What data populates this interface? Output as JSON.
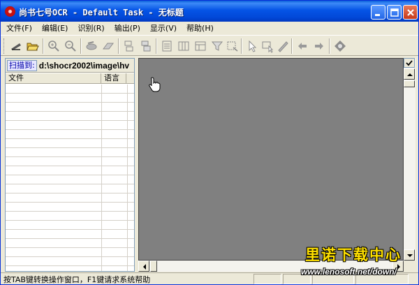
{
  "window": {
    "title": "尚书七号OCR - Default Task - 无标题",
    "controls": [
      "minimize-icon",
      "maximize-icon",
      "close-icon"
    ]
  },
  "menu": [
    "文件(F)",
    "编辑(E)",
    "识别(R)",
    "输出(P)",
    "显示(V)",
    "帮助(H)"
  ],
  "toolbar": {
    "icons": [
      "scan-icon",
      "open-folder-icon",
      "zoom-in-icon",
      "zoom-out-icon",
      "rotate-icon",
      "eraser-icon",
      "region-icon",
      "region-remove-icon",
      "text-block-icon",
      "table-block-icon",
      "image-block-icon",
      "filter-icon",
      "crop-icon",
      "pointer-icon",
      "select-region-icon",
      "pen-icon",
      "arrow-left-icon",
      "arrow-right-icon",
      "recognize-icon"
    ]
  },
  "left_panel": {
    "scan_label": "扫描到:",
    "path": "d:\\shocr2002\\image\\hv",
    "columns": [
      "文件",
      "语言"
    ],
    "rows": []
  },
  "status": {
    "text": "按TAB键转换操作窗口，F1键请求系统帮助"
  },
  "watermark": {
    "title": "里诺下载中心",
    "url": "www.lenosoft.net/down/"
  },
  "colors": {
    "titlebar": "#0554e6",
    "workspace": "#808080",
    "chrome": "#ece9d8"
  }
}
